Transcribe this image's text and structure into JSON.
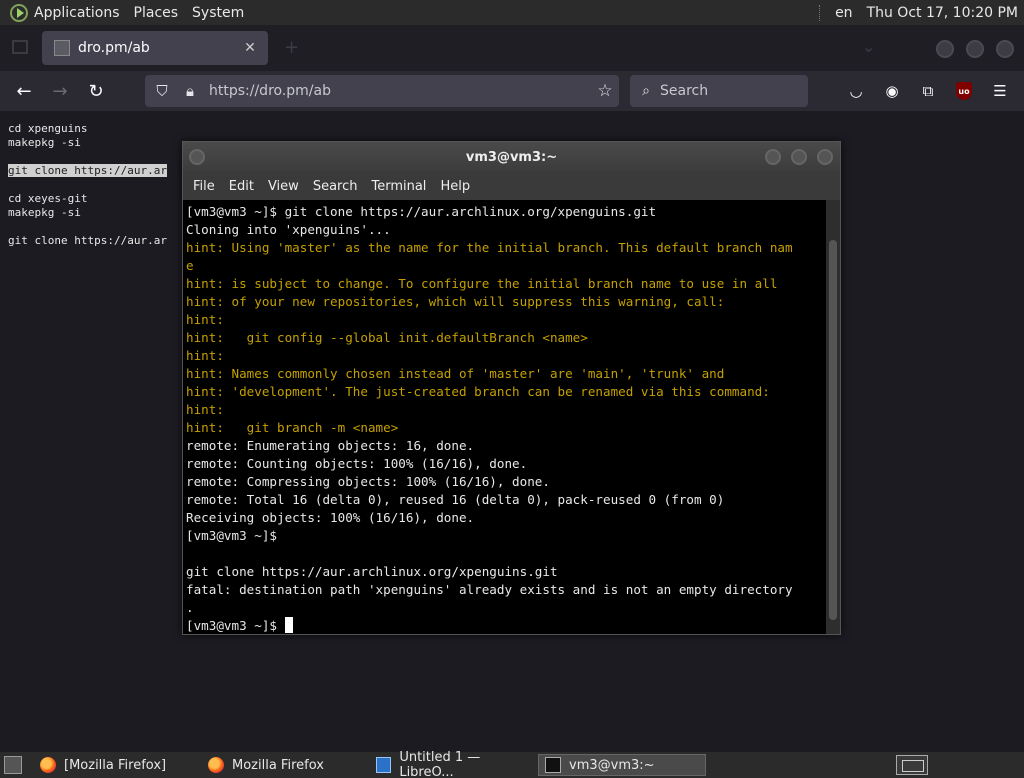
{
  "top_panel": {
    "menus": [
      "Applications",
      "Places",
      "System"
    ],
    "language": "en",
    "clock": "Thu Oct 17, 10:20 PM"
  },
  "browser": {
    "tab_title": "dro.pm/ab",
    "tab_close": "✕",
    "url": "https://dro.pm/ab",
    "search_placeholder": "Search",
    "page_lines": [
      "cd xpenguins",
      "makepkg -si",
      "",
      "git clone https://aur.ar",
      "",
      "cd xeyes-git",
      "makepkg -si",
      "",
      "git clone https://aur.ar"
    ]
  },
  "terminal": {
    "title": "vm3@vm3:~",
    "menu": [
      "File",
      "Edit",
      "View",
      "Search",
      "Terminal",
      "Help"
    ],
    "lines": [
      {
        "t": "[vm3@vm3 ~]$ git clone https://aur.archlinux.org/xpenguins.git",
        "c": "w"
      },
      {
        "t": "Cloning into 'xpenguins'...",
        "c": "w"
      },
      {
        "t": "hint: Using 'master' as the name for the initial branch. This default branch nam",
        "c": "h"
      },
      {
        "t": "e",
        "c": "h"
      },
      {
        "t": "hint: is subject to change. To configure the initial branch name to use in all",
        "c": "h"
      },
      {
        "t": "hint: of your new repositories, which will suppress this warning, call:",
        "c": "h"
      },
      {
        "t": "hint:",
        "c": "h"
      },
      {
        "t": "hint:   git config --global init.defaultBranch <name>",
        "c": "h"
      },
      {
        "t": "hint:",
        "c": "h"
      },
      {
        "t": "hint: Names commonly chosen instead of 'master' are 'main', 'trunk' and",
        "c": "h"
      },
      {
        "t": "hint: 'development'. The just-created branch can be renamed via this command:",
        "c": "h"
      },
      {
        "t": "hint:",
        "c": "h"
      },
      {
        "t": "hint:   git branch -m <name>",
        "c": "h"
      },
      {
        "t": "remote: Enumerating objects: 16, done.",
        "c": "w"
      },
      {
        "t": "remote: Counting objects: 100% (16/16), done.",
        "c": "w"
      },
      {
        "t": "remote: Compressing objects: 100% (16/16), done.",
        "c": "w"
      },
      {
        "t": "remote: Total 16 (delta 0), reused 16 (delta 0), pack-reused 0 (from 0)",
        "c": "w"
      },
      {
        "t": "Receiving objects: 100% (16/16), done.",
        "c": "w"
      },
      {
        "t": "[vm3@vm3 ~]$",
        "c": "w"
      },
      {
        "t": "",
        "c": "w"
      },
      {
        "t": "git clone https://aur.archlinux.org/xpenguins.git",
        "c": "w"
      },
      {
        "t": "fatal: destination path 'xpenguins' already exists and is not an empty directory",
        "c": "w"
      },
      {
        "t": ".",
        "c": "w"
      }
    ],
    "prompt": "[vm3@vm3 ~]$ "
  },
  "taskbar": {
    "tasks": [
      "[Mozilla Firefox]",
      "Mozilla Firefox",
      "Untitled 1 — LibreO...",
      "vm3@vm3:~"
    ]
  }
}
